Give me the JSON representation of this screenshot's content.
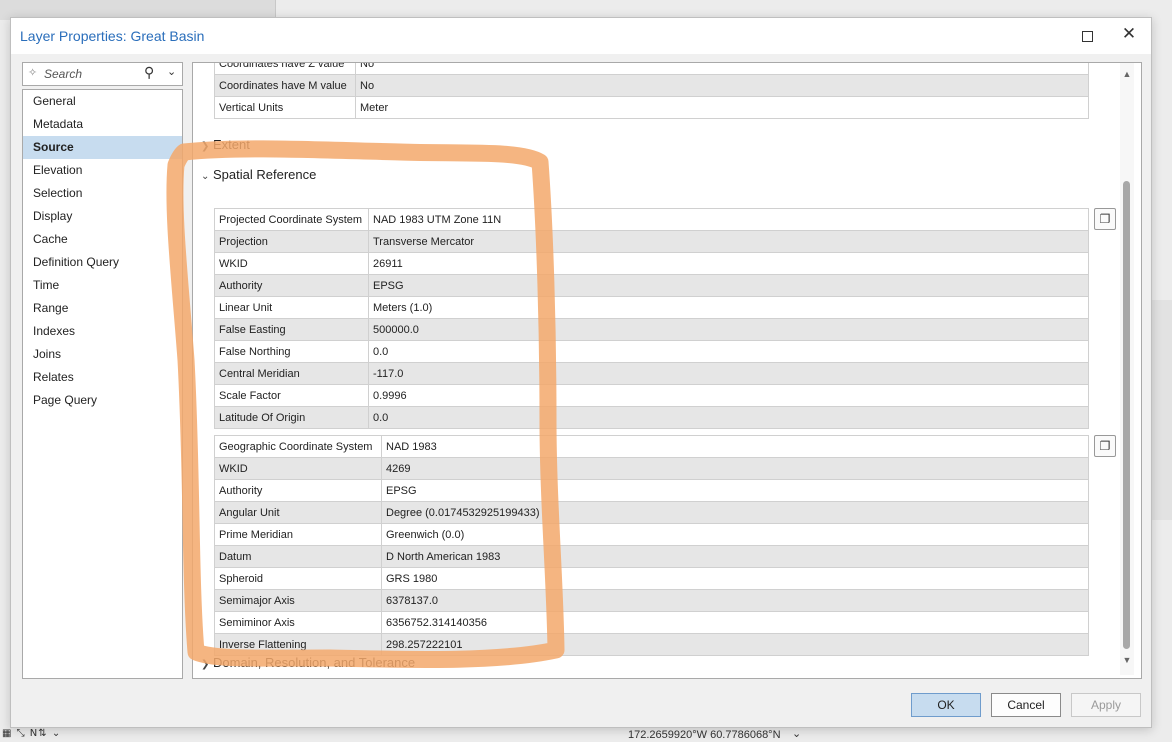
{
  "dialog": {
    "title": "Layer Properties: Great Basin",
    "maximize_icon": "maximize-icon",
    "close_glyph": "✕"
  },
  "nav": {
    "search_placeholder": "Search",
    "items": [
      "General",
      "Metadata",
      "Source",
      "Elevation",
      "Selection",
      "Display",
      "Cache",
      "Definition Query",
      "Time",
      "Range",
      "Indexes",
      "Joins",
      "Relates",
      "Page Query"
    ],
    "selected": "Source"
  },
  "top_table": [
    {
      "label": "Coordinates have Z value",
      "value": "No"
    },
    {
      "label": "Coordinates have M value",
      "value": "No"
    },
    {
      "label": "Vertical Units",
      "value": "Meter"
    }
  ],
  "sections": {
    "extent": "Extent",
    "spatial_reference": "Spatial Reference",
    "domain": "Domain, Resolution, and Tolerance"
  },
  "projected_table": [
    {
      "label": "Projected Coordinate System",
      "value": "NAD 1983 UTM Zone 11N"
    },
    {
      "label": "Projection",
      "value": "Transverse Mercator"
    },
    {
      "label": "WKID",
      "value": "26911"
    },
    {
      "label": "Authority",
      "value": "EPSG"
    },
    {
      "label": "Linear Unit",
      "value": "Meters (1.0)"
    },
    {
      "label": "False Easting",
      "value": "500000.0"
    },
    {
      "label": "False Northing",
      "value": "0.0"
    },
    {
      "label": "Central Meridian",
      "value": "-117.0"
    },
    {
      "label": "Scale Factor",
      "value": "0.9996"
    },
    {
      "label": "Latitude Of Origin",
      "value": "0.0"
    }
  ],
  "geographic_table": [
    {
      "label": "Geographic Coordinate System",
      "value": "NAD 1983"
    },
    {
      "label": "WKID",
      "value": "4269"
    },
    {
      "label": "Authority",
      "value": "EPSG"
    },
    {
      "label": "Angular Unit",
      "value": "Degree (0.0174532925199433)"
    },
    {
      "label": "Prime Meridian",
      "value": "Greenwich (0.0)"
    },
    {
      "label": "Datum",
      "value": "D North American 1983"
    },
    {
      "label": "Spheroid",
      "value": "GRS 1980"
    },
    {
      "label": "Semimajor Axis",
      "value": "6378137.0"
    },
    {
      "label": "Semiminor Axis",
      "value": "6356752.314140356"
    },
    {
      "label": "Inverse Flattening",
      "value": "298.257222101"
    }
  ],
  "buttons": {
    "ok": "OK",
    "cancel": "Cancel",
    "apply": "Apply"
  },
  "status": {
    "coords": "172.2659920°W 60.7786068°N"
  },
  "colors": {
    "title_blue": "#2a6ebb",
    "selected_bg": "#c7dcef",
    "annotation_orange": "#f3a86b"
  },
  "icons": [
    "search-icon",
    "magnifier-icon",
    "dropdown-icon",
    "copy-icon",
    "chevron-right-icon",
    "chevron-down-icon",
    "close-icon",
    "maximize-icon"
  ]
}
